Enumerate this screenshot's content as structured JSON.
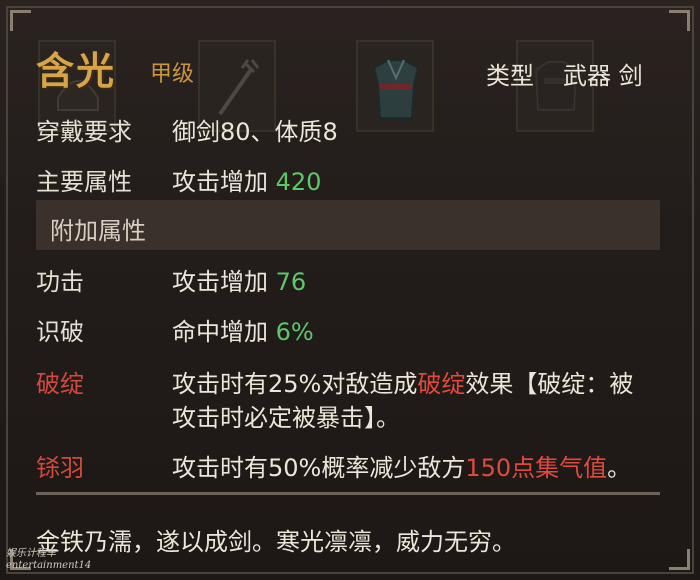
{
  "item": {
    "name": "含光",
    "grade": "甲级",
    "type_label": "类型",
    "type_value": "武器 剑"
  },
  "requirements": {
    "label": "穿戴要求",
    "value": "御剑80、体质8"
  },
  "main_attr": {
    "label": "主要属性",
    "prefix": "攻击增加",
    "value": "420"
  },
  "extra_section": {
    "label": "附加属性"
  },
  "extra_attrs": [
    {
      "label": "功击",
      "prefix": "攻击增加",
      "value": "76"
    },
    {
      "label": "识破",
      "prefix": "命中增加",
      "value": "6%"
    }
  ],
  "effects": [
    {
      "label": "破绽",
      "line1_a": "攻击时有25%对敌造成",
      "line1_highlight": "破绽",
      "line1_b": "效果【破绽：被",
      "line2": "攻击时必定被暴击】。"
    },
    {
      "label": "铩羽",
      "text_a": "攻击时有50%概率减少敌方",
      "highlight": "150点集气值",
      "text_b": "。"
    }
  ],
  "flavor_text": "金铁乃濡，遂以成剑。寒光凛凛，威力无穷。",
  "watermark": {
    "line1": "娱乐计程车",
    "line2": "entertainment14"
  },
  "icons": [
    "helmet-icon",
    "staff-icon",
    "robe-icon",
    "armor-icon"
  ],
  "colors": {
    "title": "#d8a44a",
    "positive": "#5cc86a",
    "highlight": "#e04a3c",
    "effect_label": "#d24a3e"
  }
}
